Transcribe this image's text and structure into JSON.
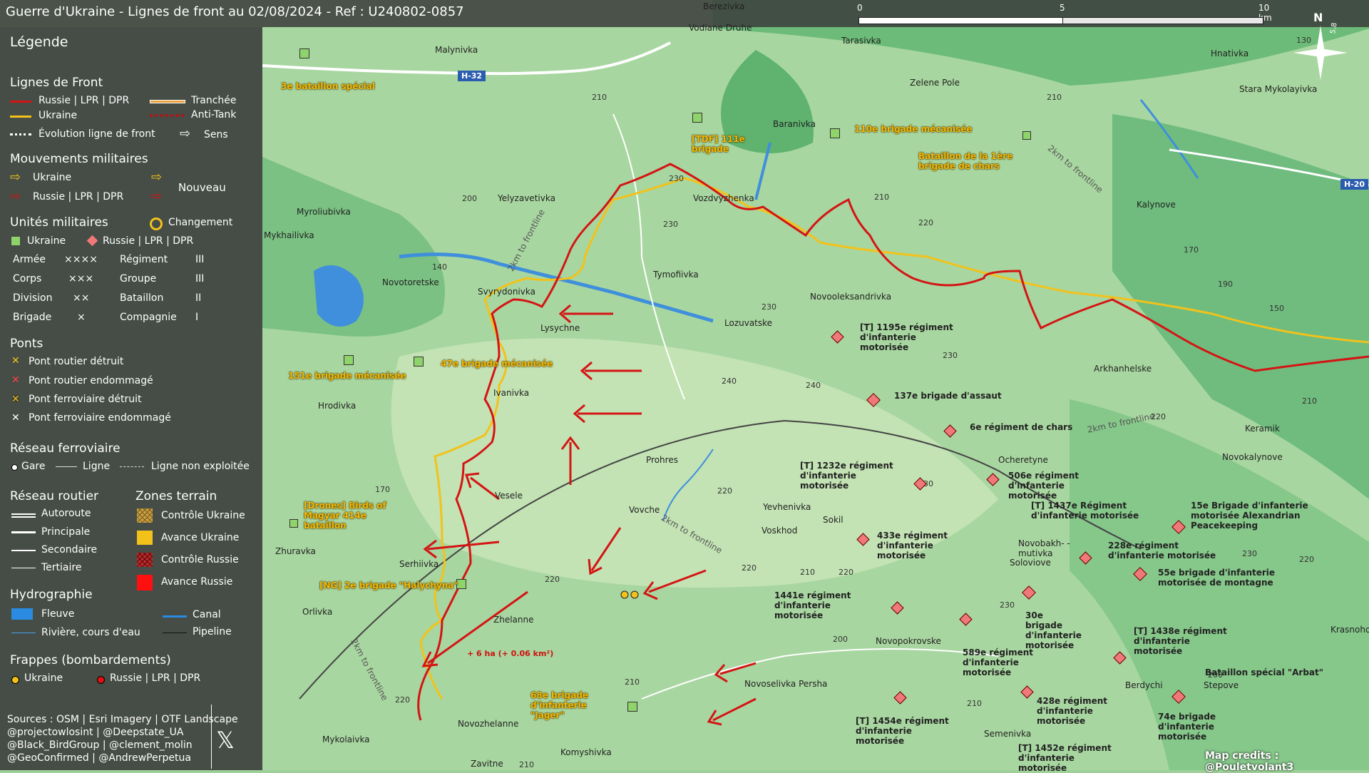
{
  "title": "Guerre d'Ukraine - Lignes de front au 02/08/2024 - Ref : U240802-0857",
  "scale": {
    "zero": "0",
    "mid": "5",
    "max": "10 km"
  },
  "compass": {
    "north": "N",
    "declination": "5.8"
  },
  "legend": {
    "title": "Légende",
    "front": {
      "heading": "Lignes de Front",
      "russia": "Russie | LPR | DPR",
      "ukraine": "Ukraine",
      "evolution": "Évolution ligne de front",
      "trench": "Tranchée",
      "antitank": "Anti-Tank",
      "direction": "Sens"
    },
    "moves": {
      "heading": "Mouvements militaires",
      "ukraine": "Ukraine",
      "russia": "Russie | LPR | DPR",
      "new": "Nouveau"
    },
    "units": {
      "heading": "Unités militaires",
      "change": "Changement",
      "ukraine": "Ukraine",
      "russia": "Russie | LPR | DPR",
      "rows": [
        {
          "a": "Armée",
          "as": "××××",
          "b": "Régiment",
          "bs": "III"
        },
        {
          "a": "Corps",
          "as": "×××",
          "b": "Groupe",
          "bs": "III"
        },
        {
          "a": "Division",
          "as": "××",
          "b": "Bataillon",
          "bs": "II"
        },
        {
          "a": "Brigade",
          "as": "×",
          "b": "Compagnie",
          "bs": "I"
        }
      ]
    },
    "bridges": {
      "heading": "Ponts",
      "items": [
        "Pont routier détruit",
        "Pont routier endommagé",
        "Pont ferroviaire détruit",
        "Pont ferroviaire endommagé"
      ]
    },
    "rail": {
      "heading": "Réseau ferroviaire",
      "station": "Gare",
      "line": "Ligne",
      "unused": "Ligne non exploitée"
    },
    "roads": {
      "heading": "Réseau routier",
      "items": [
        "Autoroute",
        "Principale",
        "Secondaire",
        "Tertiaire"
      ]
    },
    "zones": {
      "heading": "Zones terrain",
      "items": [
        "Contrôle Ukraine",
        "Avance Ukraine",
        "Contrôle Russie",
        "Avance Russie"
      ]
    },
    "hydro": {
      "heading": "Hydrographie",
      "river": "Fleuve",
      "stream": "Rivière, cours d'eau",
      "canal": "Canal",
      "pipeline": "Pipeline"
    },
    "strikes": {
      "heading": "Frappes (bombardements)",
      "ukraine": "Ukraine",
      "russia": "Russie | LPR | DPR"
    }
  },
  "sources": [
    "Sources : OSM | Esri Imagery | OTF Landscape",
    "@projectowlosint | @Deepstate_UA",
    "@Black_BirdGroup | @clement_molin",
    "@GeoConfirmed | @AndrewPerpetua"
  ],
  "credits": "Map credits : @Pouletvolant3",
  "gain": "+ 6 ha (+ 0.06 km²)",
  "colors": {
    "russia": "#d41414",
    "ukraine": "#f2c21b",
    "ukraineUnit": "#8fd46a",
    "russiaUnit": "#f07878"
  },
  "places": [
    "Berezivka",
    "Vodiane Druhe",
    "Tarasivka",
    "Malynivka",
    "Hnativka",
    "Zelene Pole",
    "Stara Mykolayivka",
    "Baranivka",
    "Vozdvyzhenka",
    "Yelyzavetivka",
    "Kalynove",
    "Myroliubivka",
    "Mykhailivka",
    "Tymofiivka",
    "Novotoretske",
    "Svyrydonivka",
    "Novooleksandrivka",
    "Lysychne",
    "Lozuvatske",
    "Arkhanhelske",
    "Ivanivka",
    "Hrodivka",
    "Keramik",
    "Ocheretyne",
    "Novokalynove",
    "Prohres",
    "Vesele",
    "Vovche",
    "Yevhenivka",
    "Sokil",
    "Voskhod",
    "Zhuravka",
    "Novobakh- -mutivka",
    "Soloviove",
    "Serhiivka",
    "Orlivka",
    "Zhelanne",
    "Novopokrovske",
    "Krasnohorivka",
    "Berdychi",
    "Stepove",
    "Novoselivka Persha",
    "Semenivka",
    "Mykolaivka",
    "Novozhelanne",
    "Komyshivka",
    "Zavitne",
    "Lozuvatske"
  ],
  "roads": [
    "H-32",
    "H-20"
  ],
  "frontlabels": [
    "2km to frontline",
    "2km to frontline",
    "2km to frontline",
    "2km to frontline",
    "2km to frontline"
  ],
  "ukunits": [
    "3e bataillon spécial",
    "[TDF] 111e brigade",
    "110e brigade mécanisée",
    "Bataillon de la 1ère brigade de chars",
    "151e brigade mécanisée",
    "47e brigade mécanisée",
    "[Drones] Birds of Magyar 414e bataillon",
    "[NG] 2e brigade \"Halychyna\"",
    "68e brigade d'infanterie \"Jager\""
  ],
  "ruunits": [
    "[T] 1195e régiment d'infanterie motorisée",
    "137e brigade d'assaut",
    "6e régiment de chars",
    "[T] 1232e régiment d'infanterie motorisée",
    "506e régiment d'infanterie motorisée",
    "[T] 1437e Régiment d'infanterie motorisée",
    "15e Brigade d'infanterie motorisée Alexandrian Peacekeeping",
    "433e régiment d'infanterie motorisée",
    "228e régiment d'infanterie motorisée",
    "55e brigade d'infanterie motorisée de montagne",
    "1441e régiment d'infanterie motorisée",
    "30e brigade d'infanterie motorisée",
    "589e régiment d'infanterie motorisée",
    "[T] 1438e régiment d'infanterie motorisée",
    "Bataillon spécial \"Arbat\"",
    "428e régiment d'infanterie motorisée",
    "74e brigade d'infanterie motorisée",
    "[T] 1454e régiment d'infanterie motorisée",
    "[T] 1452e régiment d'infanterie motorisée"
  ],
  "elevations": [
    "210",
    "200",
    "230",
    "220",
    "170",
    "140",
    "240",
    "150",
    "190",
    "130"
  ]
}
